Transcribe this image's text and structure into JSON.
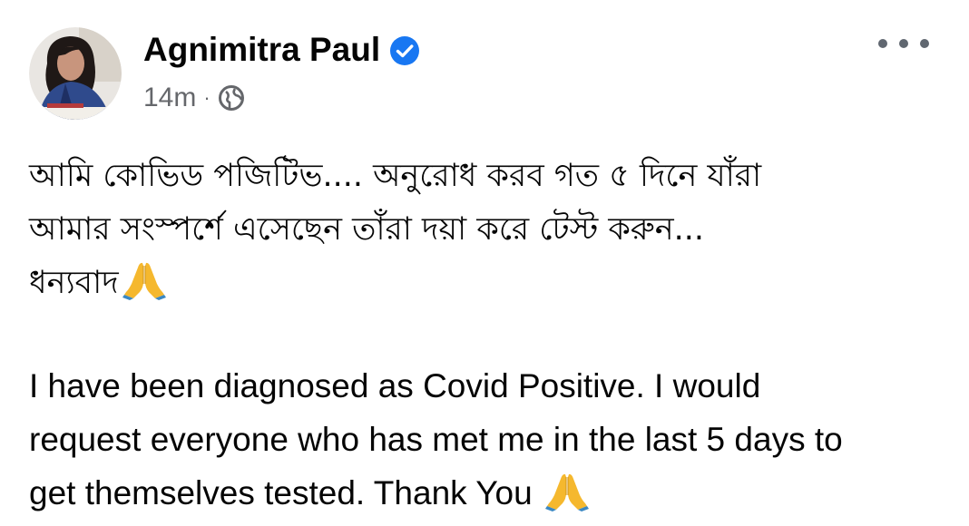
{
  "post": {
    "author_name": "Agnimitra Paul",
    "verified_icon": "verified-badge-icon",
    "timestamp": "14m",
    "separator": "·",
    "audience_icon": "globe-icon",
    "more_icon": "more-options-icon",
    "bengali_lines": [
      "আমি কোভিড পজিটিভ.... অনুরোধ করব গত ৫ দিনে যাঁরা",
      "আমার সংস্পর্শে এসেছেন তাঁরা দয়া করে টেস্ট করুন...",
      "ধন্যবাদ"
    ],
    "english_lines": [
      "I have been diagnosed as Covid Positive. I would",
      "request everyone who has met me in the last 5 days to",
      "get themselves tested. Thank You "
    ],
    "emoji_icon": "folded-hands-emoji-icon"
  },
  "colors": {
    "verified_blue": "#1877f2",
    "meta_grey": "#65676b",
    "emoji_yellow": "#f5b82e",
    "emoji_blue": "#3b88c3"
  }
}
